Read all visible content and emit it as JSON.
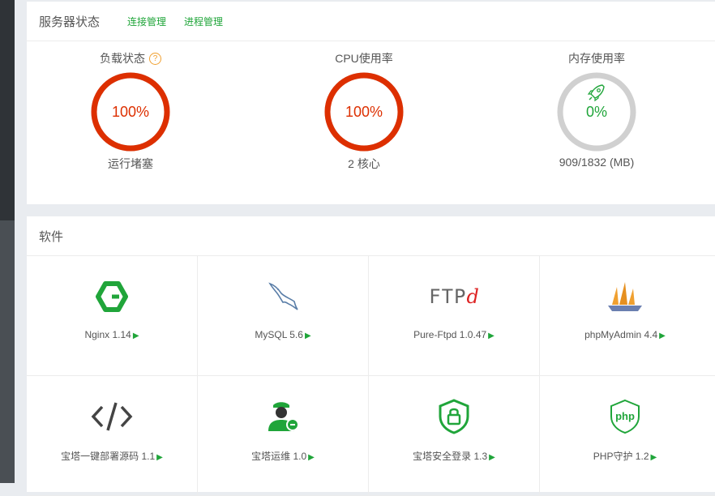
{
  "status": {
    "title": "服务器状态",
    "links": [
      "连接管理",
      "进程管理"
    ],
    "gauges": [
      {
        "label": "负载状态",
        "value": 100,
        "value_text": "100%",
        "sub": "运行堵塞",
        "color": "#dd2f00",
        "has_help": true
      },
      {
        "label": "CPU使用率",
        "value": 100,
        "value_text": "100%",
        "sub": "2 核心",
        "color": "#dd2f00"
      },
      {
        "label": "内存使用率",
        "value": 0,
        "value_text": "0%",
        "sub": "909/1832 (MB)",
        "color": "#20a53a"
      }
    ]
  },
  "software": {
    "title": "软件",
    "items": [
      {
        "name": "Nginx 1.14",
        "icon": "nginx-icon"
      },
      {
        "name": "MySQL 5.6",
        "icon": "mysql-icon"
      },
      {
        "name": "Pure-Ftpd 1.0.47",
        "icon": "ftpd-icon"
      },
      {
        "name": "phpMyAdmin 4.4",
        "icon": "phpmyadmin-icon"
      },
      {
        "name": "宝塔一键部署源码 1.1",
        "icon": "code-icon"
      },
      {
        "name": "宝塔运维 1.0",
        "icon": "ops-icon"
      },
      {
        "name": "宝塔安全登录 1.3",
        "icon": "shield-lock-icon"
      },
      {
        "name": "PHP守护 1.2",
        "icon": "php-shield-icon"
      }
    ],
    "ftp_logo": {
      "text": "FTP",
      "suffix": "d"
    },
    "php_logo": "php"
  },
  "colors": {
    "accent": "#20a53a",
    "danger": "#dd2f00",
    "ring_empty": "#d0d0d0"
  }
}
